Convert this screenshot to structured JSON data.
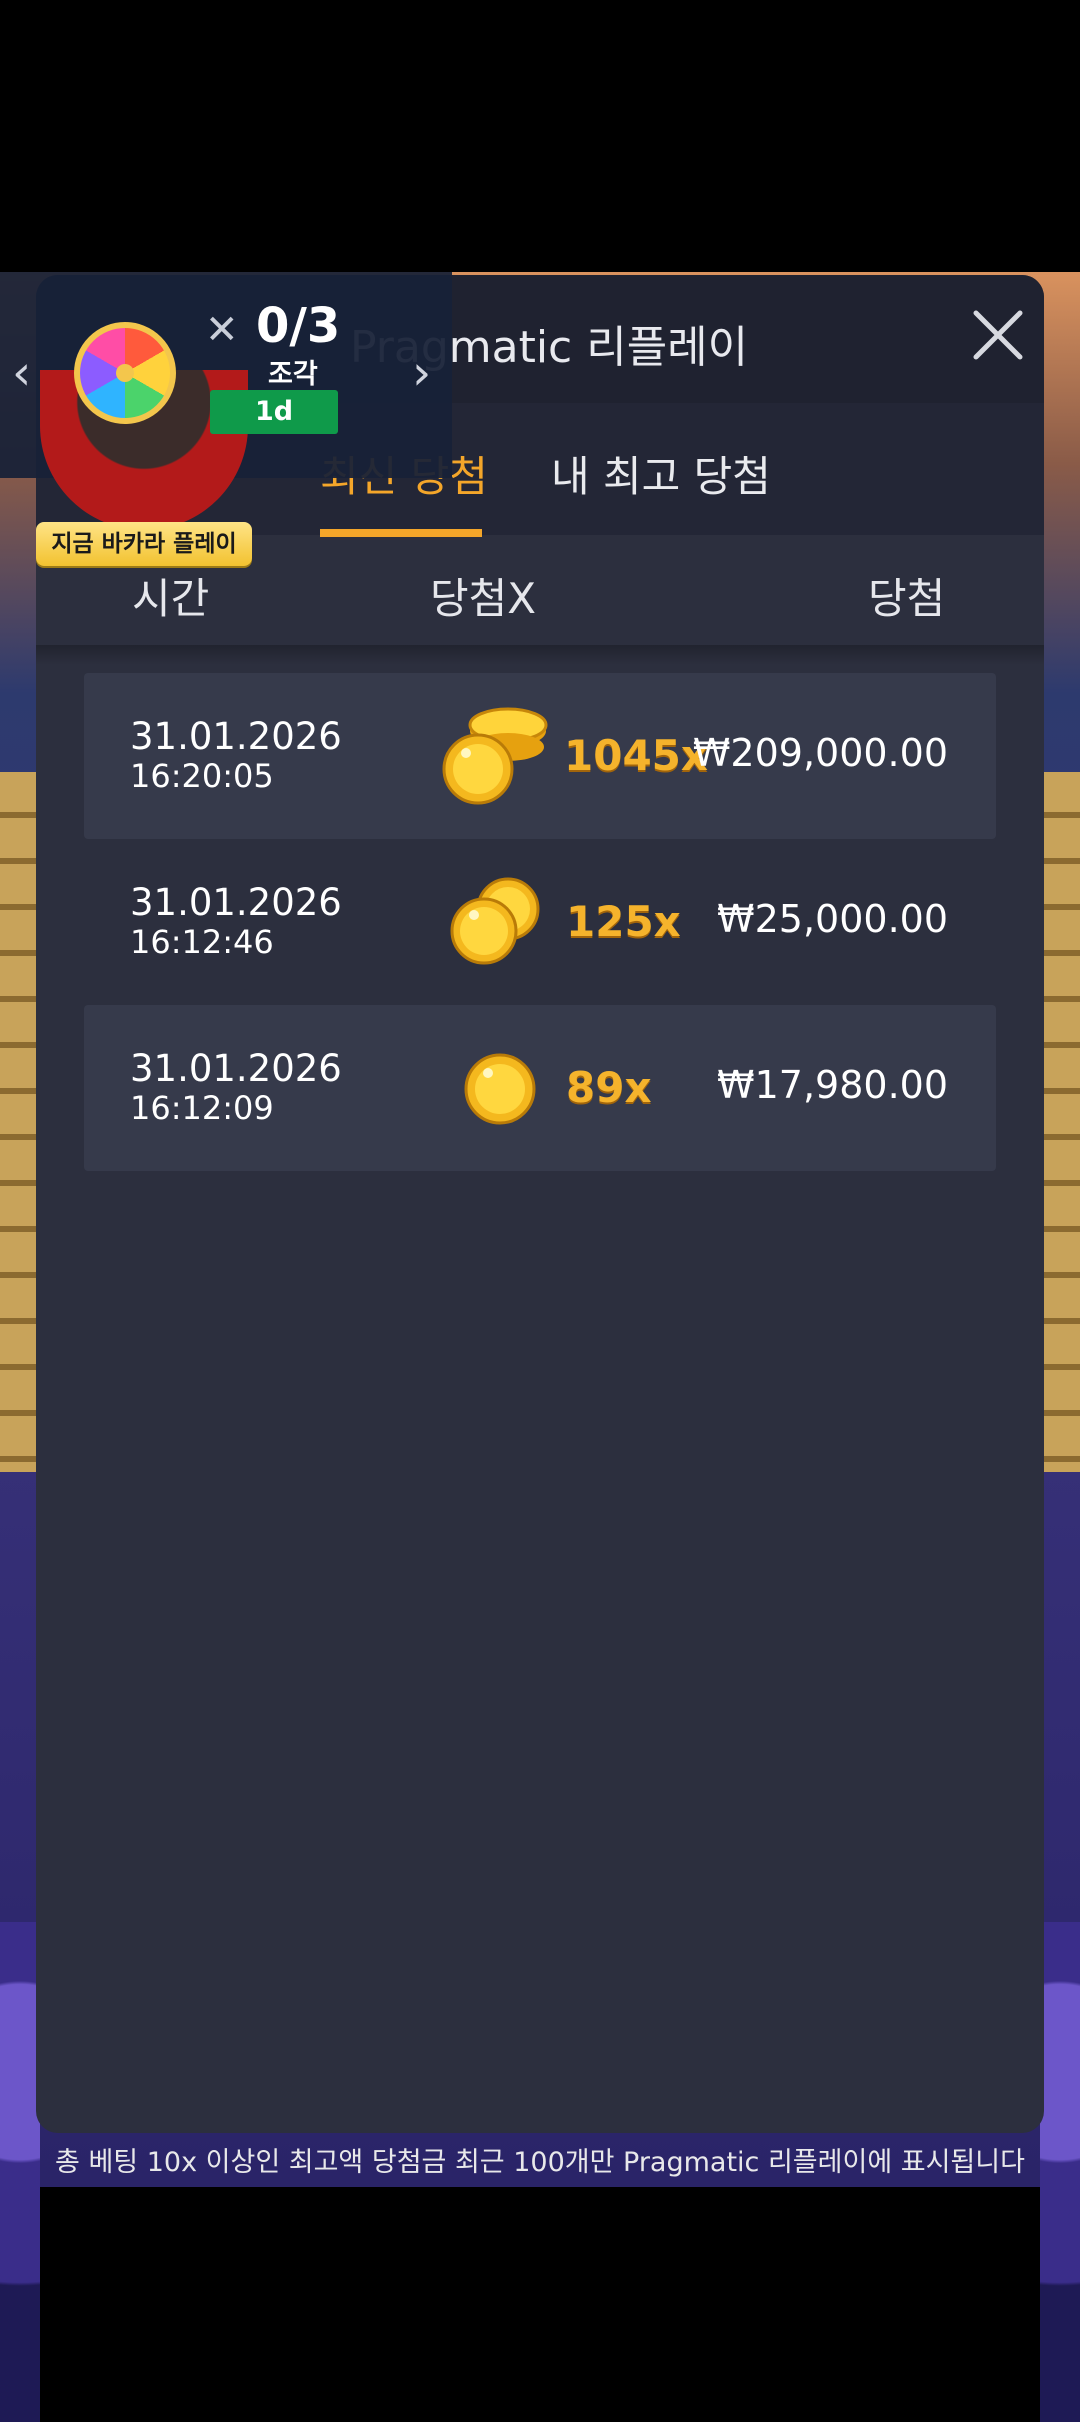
{
  "modal": {
    "title": "Pragmatic 리플레이",
    "tabs": [
      {
        "label": "최신 당첨",
        "active": true
      },
      {
        "label": "내 최고 당첨",
        "active": false
      }
    ],
    "columns": {
      "time": "시간",
      "multiplier": "당첨X",
      "win": "당첨"
    },
    "rows": [
      {
        "date": "31.01.2026",
        "time": "16:20:05",
        "multiplier": "1045x",
        "amount": "₩209,000.00",
        "coin_icon": "coin-stack-icon"
      },
      {
        "date": "31.01.2026",
        "time": "16:12:46",
        "multiplier": "125x",
        "amount": "₩25,000.00",
        "coin_icon": "coin-pair-icon"
      },
      {
        "date": "31.01.2026",
        "time": "16:12:09",
        "multiplier": "89x",
        "amount": "₩17,980.00",
        "coin_icon": "coin-single-icon"
      }
    ],
    "footer_note": "총 베팅 10x 이상인 최고액 당첨금 최근 100개만 Pragmatic 리플레이에 표시됩니다"
  },
  "promo": {
    "progress": "0/3",
    "pieces_label": "조각",
    "timer": "1d",
    "play_label": "지금 바카라 플레이",
    "prev_icon": "chevron-left-icon",
    "next_icon": "chevron-right-icon"
  },
  "colors": {
    "accent": "#f4a62a",
    "modal_bg": "#2c2f3e",
    "header_bg": "#1f2230",
    "row_shade": "#363a4b",
    "timer_green": "#0f9a4a"
  }
}
